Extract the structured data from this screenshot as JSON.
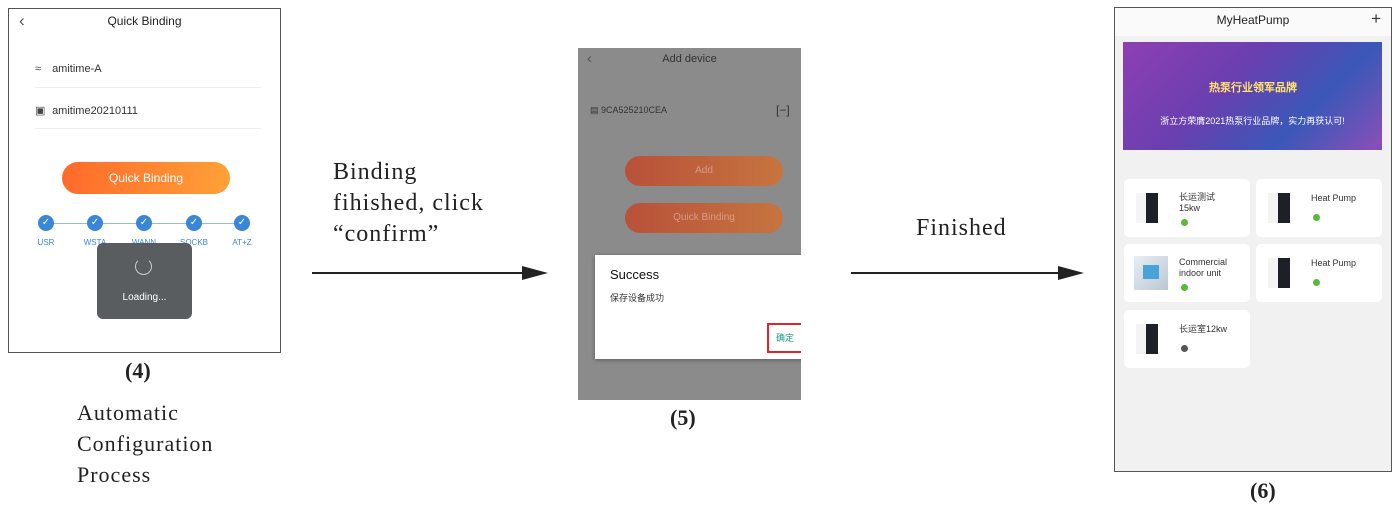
{
  "screen4": {
    "title": "Quick Binding",
    "back_icon": "chevron-left-icon",
    "wifi_icon": "wifi-icon",
    "ssid": "amitime-A",
    "lock_icon": "lock-icon",
    "password": "amitime20210111",
    "button_label": "Quick Binding",
    "steps": [
      "USR",
      "WSTA",
      "WANN",
      "SOCKB",
      "AT+Z"
    ],
    "loading_text": "Loading...",
    "caption_number": "(4)",
    "caption_lines": [
      "Automatic",
      "Configuration",
      "Process"
    ]
  },
  "arrow1": {
    "lines": [
      "Binding",
      "fihished, click",
      "“confirm”"
    ]
  },
  "screen5": {
    "title": "Add device",
    "device_id": "9CA525210CEA",
    "add_label": "Add",
    "quick_binding_label": "Quick Binding",
    "dialog_title": "Success",
    "dialog_message": "保存设备成功",
    "confirm_label": "确定",
    "caption_number": "(5)"
  },
  "arrow2": {
    "label": "Finished"
  },
  "screen6": {
    "title": "MyHeatPump",
    "plus_icon": "plus-icon",
    "banner_title": "热泵行业领军品牌",
    "banner_subtitle": "浙立方荣膺2021热泵行业品牌，实力再获认可!",
    "devices": [
      {
        "name_line1": "长运测试",
        "name_line2": "15kw",
        "status_color": "#5bb83a"
      },
      {
        "name_line1": "Heat Pump",
        "name_line2": "",
        "status_color": "#5bb83a"
      },
      {
        "name_line1": "Commercial",
        "name_line2": "indoor unit",
        "status_color": "#5bb83a"
      },
      {
        "name_line1": "Heat Pump",
        "name_line2": "",
        "status_color": "#5bb83a"
      },
      {
        "name_line1": "长运室12kw",
        "name_line2": "",
        "status_color": "#555555"
      }
    ],
    "caption_number": "(6)"
  }
}
